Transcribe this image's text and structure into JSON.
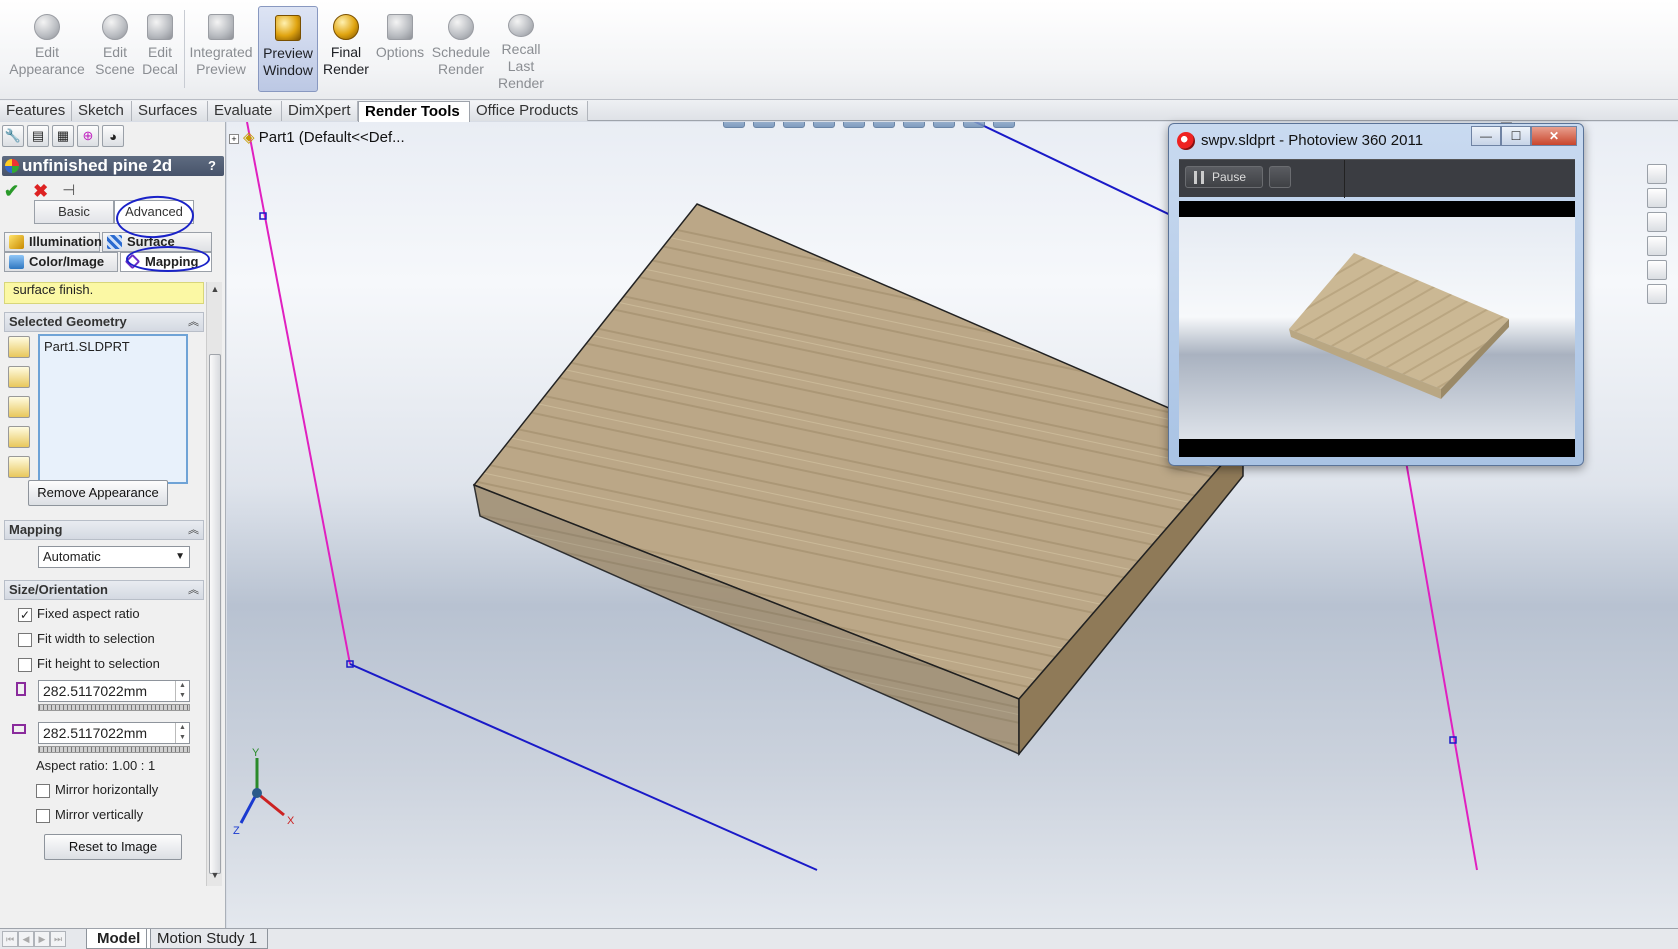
{
  "ribbon": {
    "buttons": [
      {
        "label": "Edit Appearance",
        "icon": "sphere-icon"
      },
      {
        "label": "Edit Scene",
        "icon": "scene-icon"
      },
      {
        "label": "Edit Decal",
        "icon": "decal-icon"
      },
      {
        "label": "Integrated Preview",
        "icon": "preview-icon"
      },
      {
        "label": "Preview Window",
        "icon": "preview-window-icon"
      },
      {
        "label": "Final Render",
        "icon": "render-icon"
      },
      {
        "label": "Options",
        "icon": "options-icon"
      },
      {
        "label": "Schedule Render",
        "icon": "schedule-icon"
      },
      {
        "label": "Recall Last Render",
        "icon": "recall-icon"
      }
    ]
  },
  "command_tabs": [
    "Features",
    "Sketch",
    "Surfaces",
    "Evaluate",
    "DimXpert",
    "Render Tools",
    "Office Products"
  ],
  "panel": {
    "title": "unfinished pine 2d",
    "help": "?",
    "basic_label": "Basic",
    "advanced_label": "Advanced",
    "tab_illumination": "Illumination",
    "tab_surface_finish": "Surface Finish",
    "tab_color_image": "Color/Image",
    "tab_mapping": "Mapping",
    "message": "surface finish.",
    "selected_geometry": {
      "header": "Selected Geometry",
      "item": "Part1.SLDPRT",
      "remove_button": "Remove Appearance"
    },
    "mapping": {
      "header": "Mapping",
      "value": "Automatic"
    },
    "size_orientation": {
      "header": "Size/Orientation",
      "fixed_aspect": "Fixed aspect ratio",
      "fixed_aspect_checked": true,
      "fit_width": "Fit width to selection",
      "fit_height": "Fit height to selection",
      "width_value": "282.5117022mm",
      "height_value": "282.5117022mm",
      "aspect_ratio": "Aspect ratio: 1.00 : 1",
      "mirror_h": "Mirror horizontally",
      "mirror_v": "Mirror vertically",
      "reset_button": "Reset to Image"
    }
  },
  "viewport": {
    "tree_label": "Part1  (Default<<Def..."
  },
  "photoview": {
    "title": "swpv.sldprt - Photoview 360 2011",
    "pause_label": "Pause",
    "minimize": "—",
    "maximize": "☐",
    "close": "✕"
  },
  "bottom_tabs": [
    "Model",
    "Motion Study 1"
  ],
  "colors": {
    "annotation": "#1a22c8",
    "wood": "#b9a382",
    "sketch_magenta": "#e020c0",
    "sketch_blue": "#1a1ac8"
  }
}
